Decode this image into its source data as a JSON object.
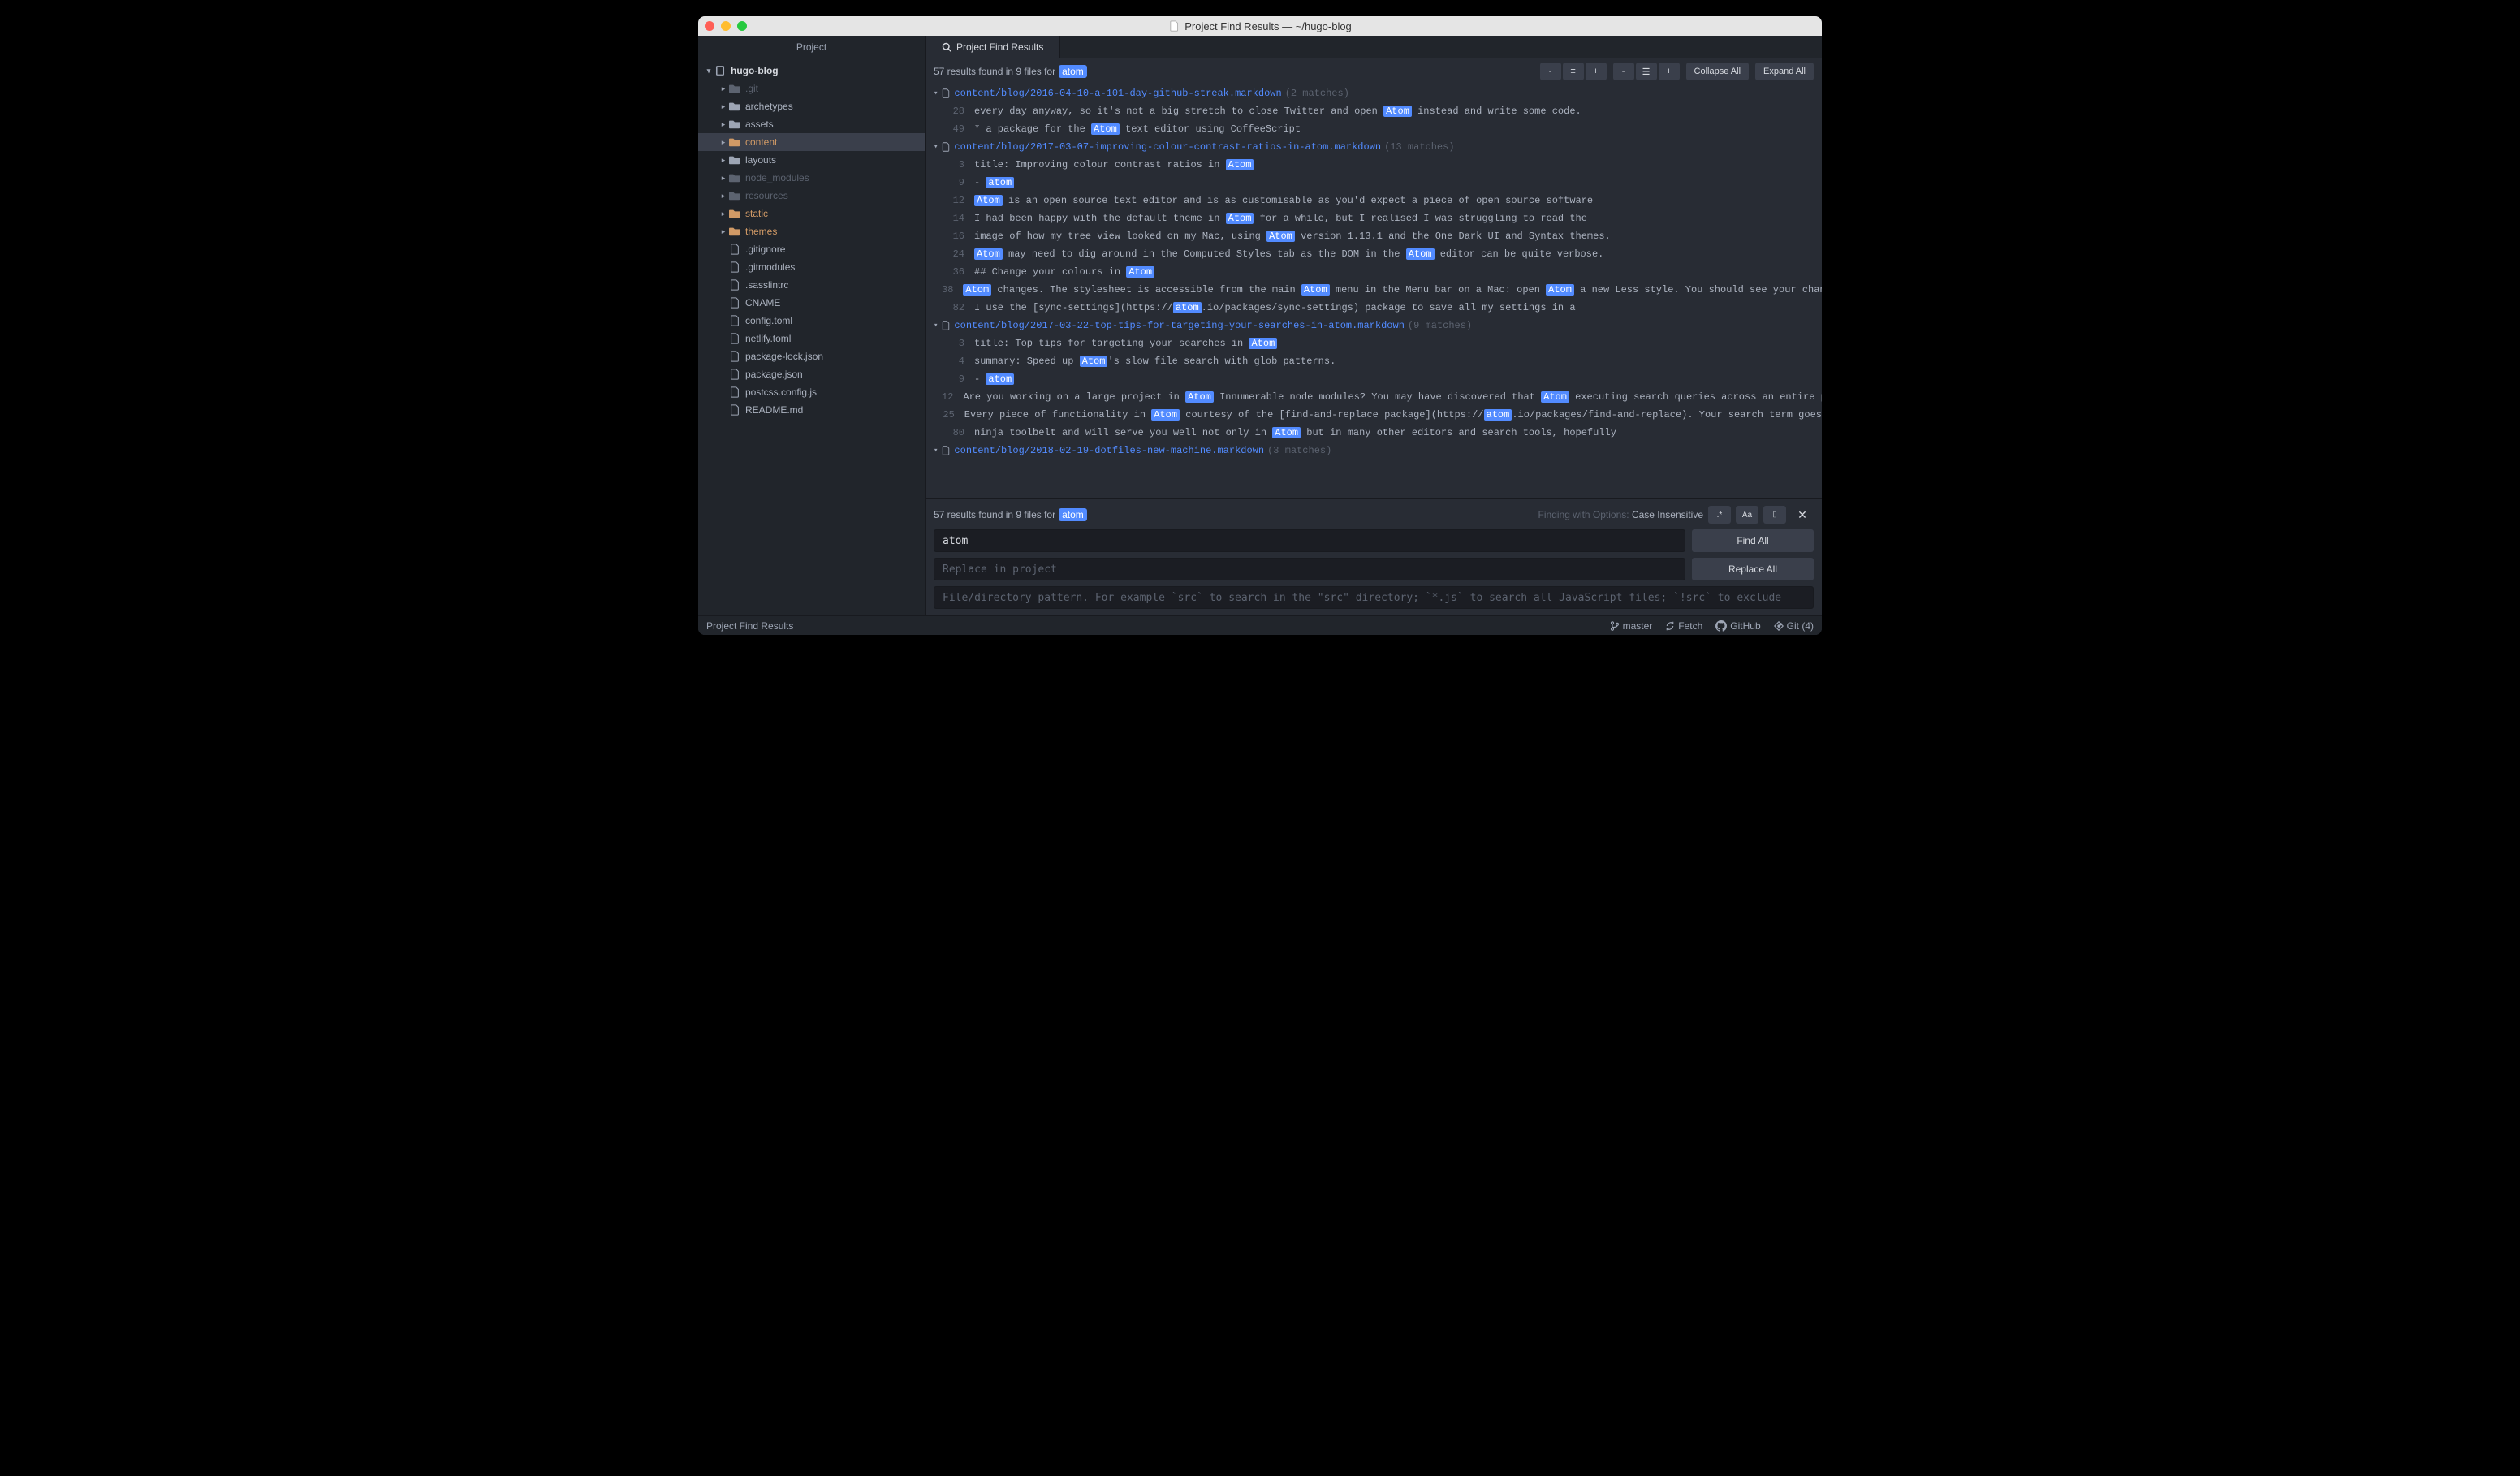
{
  "window": {
    "title": "Project Find Results — ~/hugo-blog"
  },
  "tabs": {
    "project": "Project",
    "results": "Project Find Results"
  },
  "sidebar": {
    "root": "hugo-blog",
    "items": [
      {
        "name": ".git",
        "type": "folder",
        "state": "ignored"
      },
      {
        "name": "archetypes",
        "type": "folder"
      },
      {
        "name": "assets",
        "type": "folder"
      },
      {
        "name": "content",
        "type": "folder",
        "state": "changed selected"
      },
      {
        "name": "layouts",
        "type": "folder"
      },
      {
        "name": "node_modules",
        "type": "folder",
        "state": "ignored"
      },
      {
        "name": "resources",
        "type": "folder",
        "state": "ignored"
      },
      {
        "name": "static",
        "type": "folder",
        "state": "changed"
      },
      {
        "name": "themes",
        "type": "folder",
        "state": "changed"
      },
      {
        "name": ".gitignore",
        "type": "file"
      },
      {
        "name": ".gitmodules",
        "type": "file"
      },
      {
        "name": ".sasslintrc",
        "type": "file"
      },
      {
        "name": "CNAME",
        "type": "file"
      },
      {
        "name": "config.toml",
        "type": "file"
      },
      {
        "name": "netlify.toml",
        "type": "file"
      },
      {
        "name": "package-lock.json",
        "type": "file"
      },
      {
        "name": "package.json",
        "type": "file"
      },
      {
        "name": "postcss.config.js",
        "type": "file"
      },
      {
        "name": "README.md",
        "type": "file"
      }
    ]
  },
  "results": {
    "summary_prefix": "57 results found in 9 files for",
    "search_term": "atom",
    "collapse_label": "Collapse All",
    "expand_label": "Expand All",
    "files": [
      {
        "path": "content/blog/2016-04-10-a-101-day-github-streak.markdown",
        "match_count": "(2 matches)",
        "lines": [
          {
            "num": "28",
            "segments": [
              "every day anyway, so it's not a big stretch to close Twitter and open ",
              {
                "m": "Atom"
              },
              " instead and write some code."
            ]
          },
          {
            "num": "49",
            "segments": [
              "* a package for the ",
              {
                "m": "Atom"
              },
              " text editor using CoffeeScript"
            ]
          }
        ]
      },
      {
        "path": "content/blog/2017-03-07-improving-colour-contrast-ratios-in-atom.markdown",
        "match_count": "(13 matches)",
        "lines": [
          {
            "num": "3",
            "segments": [
              "title: Improving colour contrast ratios in ",
              {
                "m": "Atom"
              }
            ]
          },
          {
            "num": "9",
            "segments": [
              "- ",
              {
                "m": "atom"
              }
            ]
          },
          {
            "num": "12",
            "segments": [
              {
                "m": "Atom"
              },
              " is an open source text editor and is as customisable as you'd expect a piece of open source software"
            ]
          },
          {
            "num": "14",
            "segments": [
              "I had been happy with the default theme in ",
              {
                "m": "Atom"
              },
              " for a while, but I realised I was struggling to read the"
            ]
          },
          {
            "num": "16",
            "segments": [
              "image of how my tree view looked on my Mac, using ",
              {
                "m": "Atom"
              },
              " version 1.13.1 and the One Dark UI and Syntax themes."
            ]
          },
          {
            "num": "24",
            "segments": [
              {
                "m": "Atom"
              },
              " may need to dig around in the Computed Styles tab as the DOM in the ",
              {
                "m": "Atom"
              },
              " editor can be quite verbose."
            ]
          },
          {
            "num": "36",
            "segments": [
              "## Change your colours in ",
              {
                "m": "Atom"
              }
            ]
          },
          {
            "num": "38",
            "segments": [
              {
                "m": "Atom"
              },
              " changes. The stylesheet is accessible from the main ",
              {
                "m": "Atom"
              },
              " menu in the Menu bar on a Mac: open ",
              {
                "m": "Atom"
              },
              " a new Less style. You should see your changes a"
            ]
          },
          {
            "num": "82",
            "segments": [
              "I use the [sync-settings](https://",
              {
                "m": "atom"
              },
              ".io/packages/sync-settings) package to save all my settings in a"
            ]
          }
        ]
      },
      {
        "path": "content/blog/2017-03-22-top-tips-for-targeting-your-searches-in-atom.markdown",
        "match_count": "(9 matches)",
        "lines": [
          {
            "num": "3",
            "segments": [
              "title: Top tips for targeting your searches in ",
              {
                "m": "Atom"
              }
            ]
          },
          {
            "num": "4",
            "segments": [
              "summary: Speed up ",
              {
                "m": "Atom"
              },
              "'s slow file search with glob patterns."
            ]
          },
          {
            "num": "9",
            "segments": [
              "- ",
              {
                "m": "atom"
              }
            ]
          },
          {
            "num": "12",
            "segments": [
              "Are you working on a large project in ",
              {
                "m": "Atom"
              },
              " Innumerable node modules? You may have discovered that ",
              {
                "m": "Atom"
              },
              " executing search queries across an entire projec"
            ]
          },
          {
            "num": "25",
            "segments": [
              "Every piece of functionality in ",
              {
                "m": "Atom"
              },
              " courtesy of the [find-and-replace package](https://",
              {
                "m": "atom"
              },
              ".io/packages/find-and-replace). Your search term goes"
            ]
          },
          {
            "num": "80",
            "segments": [
              "ninja toolbelt and will serve you well not only in ",
              {
                "m": "Atom"
              },
              " but in many other editors and search tools, hopefully"
            ]
          }
        ]
      },
      {
        "path": "content/blog/2018-02-19-dotfiles-new-machine.markdown",
        "match_count": "(3 matches)",
        "lines": []
      }
    ]
  },
  "search_panel": {
    "options_label": "Finding with Options:",
    "options_value": "Case Insensitive",
    "find_value": "atom",
    "replace_placeholder": "Replace in project",
    "pattern_placeholder": "File/directory pattern. For example `src` to search in the \"src\" directory; `*.js` to search all JavaScript files; `!src` to exclude",
    "find_all": "Find All",
    "replace_all": "Replace All"
  },
  "statusbar": {
    "left": "Project Find Results",
    "branch": "master",
    "fetch": "Fetch",
    "github": "GitHub",
    "git": "Git (4)"
  }
}
